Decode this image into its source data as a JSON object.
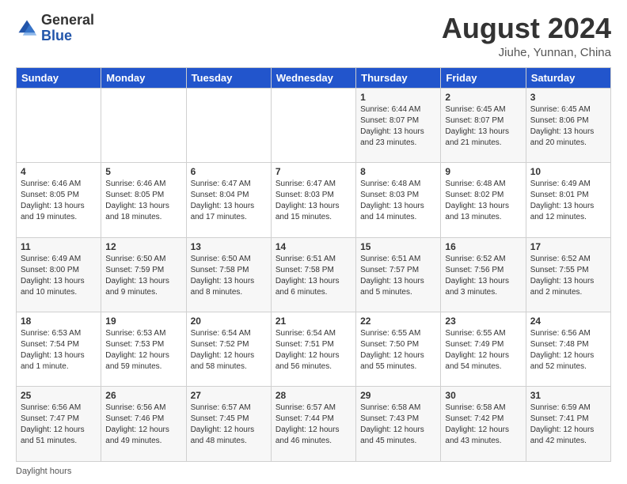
{
  "header": {
    "logo_general": "General",
    "logo_blue": "Blue",
    "month_title": "August 2024",
    "location": "Jiuhe, Yunnan, China"
  },
  "days_of_week": [
    "Sunday",
    "Monday",
    "Tuesday",
    "Wednesday",
    "Thursday",
    "Friday",
    "Saturday"
  ],
  "weeks": [
    [
      {
        "day": "",
        "info": ""
      },
      {
        "day": "",
        "info": ""
      },
      {
        "day": "",
        "info": ""
      },
      {
        "day": "",
        "info": ""
      },
      {
        "day": "1",
        "info": "Sunrise: 6:44 AM\nSunset: 8:07 PM\nDaylight: 13 hours\nand 23 minutes."
      },
      {
        "day": "2",
        "info": "Sunrise: 6:45 AM\nSunset: 8:07 PM\nDaylight: 13 hours\nand 21 minutes."
      },
      {
        "day": "3",
        "info": "Sunrise: 6:45 AM\nSunset: 8:06 PM\nDaylight: 13 hours\nand 20 minutes."
      }
    ],
    [
      {
        "day": "4",
        "info": "Sunrise: 6:46 AM\nSunset: 8:05 PM\nDaylight: 13 hours\nand 19 minutes."
      },
      {
        "day": "5",
        "info": "Sunrise: 6:46 AM\nSunset: 8:05 PM\nDaylight: 13 hours\nand 18 minutes."
      },
      {
        "day": "6",
        "info": "Sunrise: 6:47 AM\nSunset: 8:04 PM\nDaylight: 13 hours\nand 17 minutes."
      },
      {
        "day": "7",
        "info": "Sunrise: 6:47 AM\nSunset: 8:03 PM\nDaylight: 13 hours\nand 15 minutes."
      },
      {
        "day": "8",
        "info": "Sunrise: 6:48 AM\nSunset: 8:03 PM\nDaylight: 13 hours\nand 14 minutes."
      },
      {
        "day": "9",
        "info": "Sunrise: 6:48 AM\nSunset: 8:02 PM\nDaylight: 13 hours\nand 13 minutes."
      },
      {
        "day": "10",
        "info": "Sunrise: 6:49 AM\nSunset: 8:01 PM\nDaylight: 13 hours\nand 12 minutes."
      }
    ],
    [
      {
        "day": "11",
        "info": "Sunrise: 6:49 AM\nSunset: 8:00 PM\nDaylight: 13 hours\nand 10 minutes."
      },
      {
        "day": "12",
        "info": "Sunrise: 6:50 AM\nSunset: 7:59 PM\nDaylight: 13 hours\nand 9 minutes."
      },
      {
        "day": "13",
        "info": "Sunrise: 6:50 AM\nSunset: 7:58 PM\nDaylight: 13 hours\nand 8 minutes."
      },
      {
        "day": "14",
        "info": "Sunrise: 6:51 AM\nSunset: 7:58 PM\nDaylight: 13 hours\nand 6 minutes."
      },
      {
        "day": "15",
        "info": "Sunrise: 6:51 AM\nSunset: 7:57 PM\nDaylight: 13 hours\nand 5 minutes."
      },
      {
        "day": "16",
        "info": "Sunrise: 6:52 AM\nSunset: 7:56 PM\nDaylight: 13 hours\nand 3 minutes."
      },
      {
        "day": "17",
        "info": "Sunrise: 6:52 AM\nSunset: 7:55 PM\nDaylight: 13 hours\nand 2 minutes."
      }
    ],
    [
      {
        "day": "18",
        "info": "Sunrise: 6:53 AM\nSunset: 7:54 PM\nDaylight: 13 hours\nand 1 minute."
      },
      {
        "day": "19",
        "info": "Sunrise: 6:53 AM\nSunset: 7:53 PM\nDaylight: 12 hours\nand 59 minutes."
      },
      {
        "day": "20",
        "info": "Sunrise: 6:54 AM\nSunset: 7:52 PM\nDaylight: 12 hours\nand 58 minutes."
      },
      {
        "day": "21",
        "info": "Sunrise: 6:54 AM\nSunset: 7:51 PM\nDaylight: 12 hours\nand 56 minutes."
      },
      {
        "day": "22",
        "info": "Sunrise: 6:55 AM\nSunset: 7:50 PM\nDaylight: 12 hours\nand 55 minutes."
      },
      {
        "day": "23",
        "info": "Sunrise: 6:55 AM\nSunset: 7:49 PM\nDaylight: 12 hours\nand 54 minutes."
      },
      {
        "day": "24",
        "info": "Sunrise: 6:56 AM\nSunset: 7:48 PM\nDaylight: 12 hours\nand 52 minutes."
      }
    ],
    [
      {
        "day": "25",
        "info": "Sunrise: 6:56 AM\nSunset: 7:47 PM\nDaylight: 12 hours\nand 51 minutes."
      },
      {
        "day": "26",
        "info": "Sunrise: 6:56 AM\nSunset: 7:46 PM\nDaylight: 12 hours\nand 49 minutes."
      },
      {
        "day": "27",
        "info": "Sunrise: 6:57 AM\nSunset: 7:45 PM\nDaylight: 12 hours\nand 48 minutes."
      },
      {
        "day": "28",
        "info": "Sunrise: 6:57 AM\nSunset: 7:44 PM\nDaylight: 12 hours\nand 46 minutes."
      },
      {
        "day": "29",
        "info": "Sunrise: 6:58 AM\nSunset: 7:43 PM\nDaylight: 12 hours\nand 45 minutes."
      },
      {
        "day": "30",
        "info": "Sunrise: 6:58 AM\nSunset: 7:42 PM\nDaylight: 12 hours\nand 43 minutes."
      },
      {
        "day": "31",
        "info": "Sunrise: 6:59 AM\nSunset: 7:41 PM\nDaylight: 12 hours\nand 42 minutes."
      }
    ]
  ],
  "footer": {
    "label": "Daylight hours"
  }
}
